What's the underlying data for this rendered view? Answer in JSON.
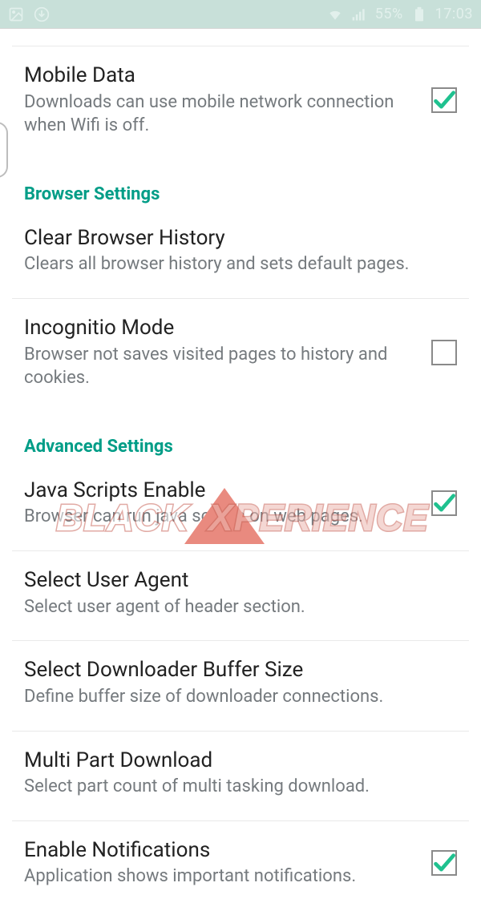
{
  "status": {
    "battery_pct": "55%",
    "time": "17:03"
  },
  "sections": {
    "s0": {
      "mobile_data": {
        "title": "Mobile Data",
        "desc": "Downloads can use mobile network connection when Wifi is off."
      }
    },
    "browser": {
      "header": "Browser Settings",
      "clear_history": {
        "title": "Clear Browser History",
        "desc": "Clears all browser history and sets default pages."
      },
      "incognito": {
        "title": "Incognitio Mode",
        "desc": "Browser not saves visited pages to history and cookies."
      }
    },
    "advanced": {
      "header": "Advanced Settings",
      "js": {
        "title": "Java Scripts Enable",
        "desc": "Browser can run java scripts on web pages."
      },
      "ua": {
        "title": "Select User Agent",
        "desc": "Select user agent of header section."
      },
      "buffer": {
        "title": "Select Downloader Buffer Size",
        "desc": "Define buffer size of downloader connections."
      },
      "multipart": {
        "title": "Multi Part Download",
        "desc": "Select part count of multi tasking download."
      },
      "notifications": {
        "title": "Enable Notifications",
        "desc": "Application shows important notifications."
      }
    }
  },
  "watermark": {
    "black": "BLACK",
    "xperience": "XPERIENCE"
  }
}
